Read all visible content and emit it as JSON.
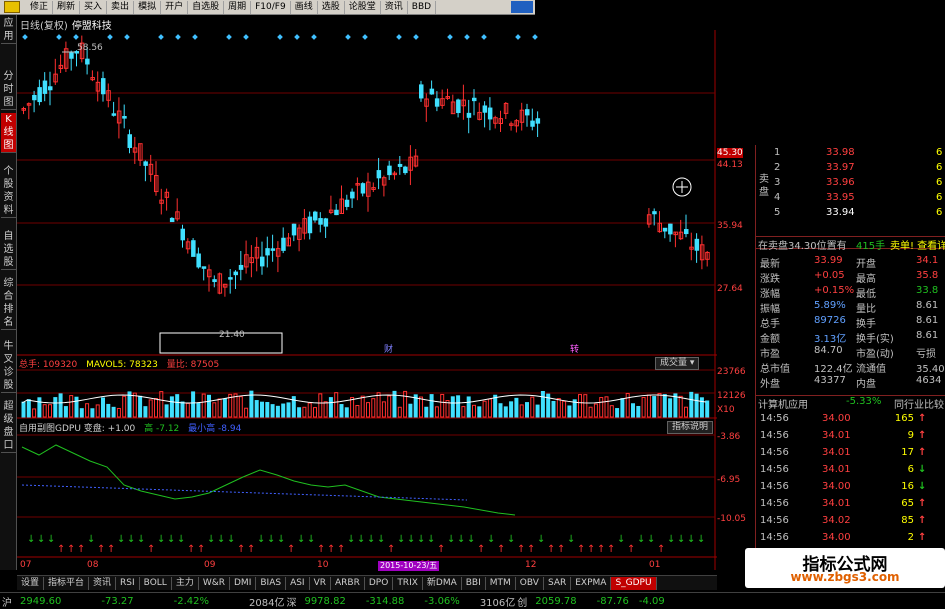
{
  "toolbar": {
    "items": [
      "修正",
      "刷新",
      "买入",
      "卖出",
      "模拟",
      "开户",
      "自选股",
      "周期",
      "F10/F9",
      "画线",
      "选股",
      "论股堂",
      "资讯",
      "BBD"
    ]
  },
  "side_tabs": [
    "应用",
    "分时图",
    "K线图",
    "个股资料",
    "自选股",
    "综合排名",
    "牛叉诊股",
    "超级盘口"
  ],
  "chart": {
    "title_prefix": "日线(复权)",
    "stock_name": "停盟科技",
    "high_label": "58.56",
    "low_label": "21.40",
    "cai_marker": "财",
    "zhuan_marker": "转",
    "price_levels": [
      "45.30",
      "44.13",
      "35.94",
      "27.64"
    ],
    "volume_levels": [
      "23766",
      "12126",
      "X10"
    ],
    "indicator_levels": [
      "-3.86",
      "-6.95",
      "-10.05"
    ],
    "date_labels": [
      "07",
      "08",
      "09",
      "10",
      "11",
      "12",
      "01"
    ],
    "date_flag": "2015-10-23/五"
  },
  "volume_legend": {
    "total": "总手: 109320",
    "mavol": "MAVOL5: 78323",
    "ratio": "量比: 87505",
    "button": "成交量"
  },
  "indicator_legend": {
    "name": "自用副图GDPU 变盘: +1.00",
    "max": "高 -7.12",
    "min": "最小高 -8.94",
    "button": "指标说明"
  },
  "order_book": {
    "sell_side_label": "卖盘",
    "rows": [
      {
        "level": "1",
        "price": "33.98",
        "qty": "6"
      },
      {
        "level": "2",
        "price": "33.97",
        "qty": "6"
      },
      {
        "level": "3",
        "price": "33.96",
        "qty": "6"
      },
      {
        "level": "4",
        "price": "33.95",
        "qty": "6"
      },
      {
        "level": "5",
        "price": "33.94",
        "qty": "6"
      }
    ],
    "info_line": "在卖盘34.30位置有",
    "info_qty": "415手",
    "info_link": "卖单! 查看详情"
  },
  "quote": [
    {
      "l1": "最新",
      "v1": "33.99",
      "l2": "开盘",
      "v2": "34.1"
    },
    {
      "l1": "涨跌",
      "v1": "+0.05",
      "l2": "最高",
      "v2": "35.8"
    },
    {
      "l1": "涨幅",
      "v1": "+0.15%",
      "l2": "最低",
      "v2": "33.8"
    },
    {
      "l1": "振幅",
      "v1": "5.89%",
      "l2": "量比",
      "v2": "8.61"
    },
    {
      "l1": "总手",
      "v1": "89726",
      "l2": "换手",
      "v2": "8.61"
    },
    {
      "l1": "金额",
      "v1": "3.13亿",
      "l2": "换手(实)",
      "v2": "8.61"
    },
    {
      "l1": "市盈",
      "v1": "84.70",
      "l2": "市盈(动)",
      "v2": "亏损"
    },
    {
      "l1": "总市值",
      "v1": "122.4亿",
      "l2": "流通值",
      "v2": "35.40亿"
    },
    {
      "l1": "外盘",
      "v1": "43377",
      "l2": "内盘",
      "v2": "4634"
    }
  ],
  "industry": {
    "name": "计算机应用",
    "change": "-5.33%",
    "button": "同行业比较"
  },
  "ticks": [
    {
      "time": "14:56",
      "price": "34.00",
      "qty": "165",
      "dir": "up"
    },
    {
      "time": "14:56",
      "price": "34.01",
      "qty": "9",
      "dir": "up"
    },
    {
      "time": "14:56",
      "price": "34.01",
      "qty": "17",
      "dir": "up"
    },
    {
      "time": "14:56",
      "price": "34.01",
      "qty": "6",
      "dir": "down"
    },
    {
      "time": "14:56",
      "price": "34.00",
      "qty": "16",
      "dir": "down"
    },
    {
      "time": "14:56",
      "price": "34.01",
      "qty": "65",
      "dir": "up"
    },
    {
      "time": "14:56",
      "price": "34.02",
      "qty": "85",
      "dir": "up"
    },
    {
      "time": "14:56",
      "price": "34.00",
      "qty": "2",
      "dir": "up"
    }
  ],
  "bottom_tabs": [
    "设置",
    "指标平台",
    "资讯",
    "RSI",
    "BOLL",
    "主力",
    "W&R",
    "DMI",
    "BIAS",
    "ASI",
    "VR",
    "ARBR",
    "DPO",
    "TRIX",
    "新DMA",
    "BBI",
    "MTM",
    "OBV",
    "SAR",
    "EXPMA",
    "S_GDPU"
  ],
  "statusbar": {
    "market": "沪",
    "index": "2949.60",
    "change": "-73.27",
    "pct": "-2.42%",
    "amount": "2084亿",
    "market2": "深",
    "index2": "9978.82",
    "change2": "-314.88",
    "pct2": "-3.06%",
    "amount2": "3106亿",
    "market3": "创",
    "index3": "2059.78",
    "change3": "-87.76",
    "pct3": "-4.09"
  },
  "watermark": {
    "title": "指标公式网",
    "url": "www.zbgs3.com"
  },
  "colors": {
    "up": "#ff3030",
    "down": "#40e0ff",
    "grid": "#700000",
    "green": "#20c020",
    "yellow": "#ffff00",
    "text": "#c0c0c0"
  }
}
